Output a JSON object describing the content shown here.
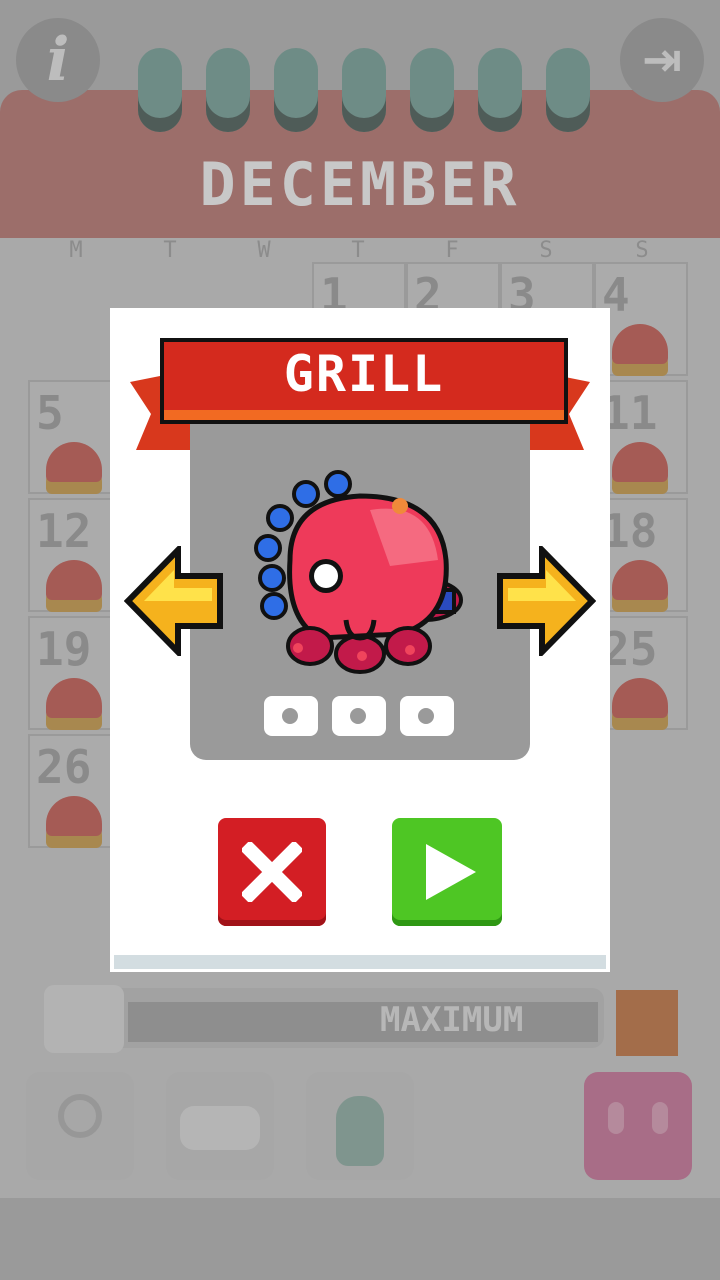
{
  "calendar": {
    "month": "DECEMBER",
    "weekdays": [
      "M",
      "T",
      "W",
      "T",
      "F",
      "S",
      "S"
    ],
    "visible_days": [
      "1",
      "2",
      "3",
      "4",
      "5",
      "11",
      "12",
      "18",
      "19",
      "25",
      "26"
    ],
    "progress_label": "MAXIMUM"
  },
  "dialog": {
    "character_name": "GRILL",
    "stars_total": 3,
    "stars_earned": 0
  },
  "colors": {
    "ribbon": "#d42a1e",
    "cancel": "#d31e24",
    "play": "#4ec624",
    "arrow": "#f5b21d"
  }
}
